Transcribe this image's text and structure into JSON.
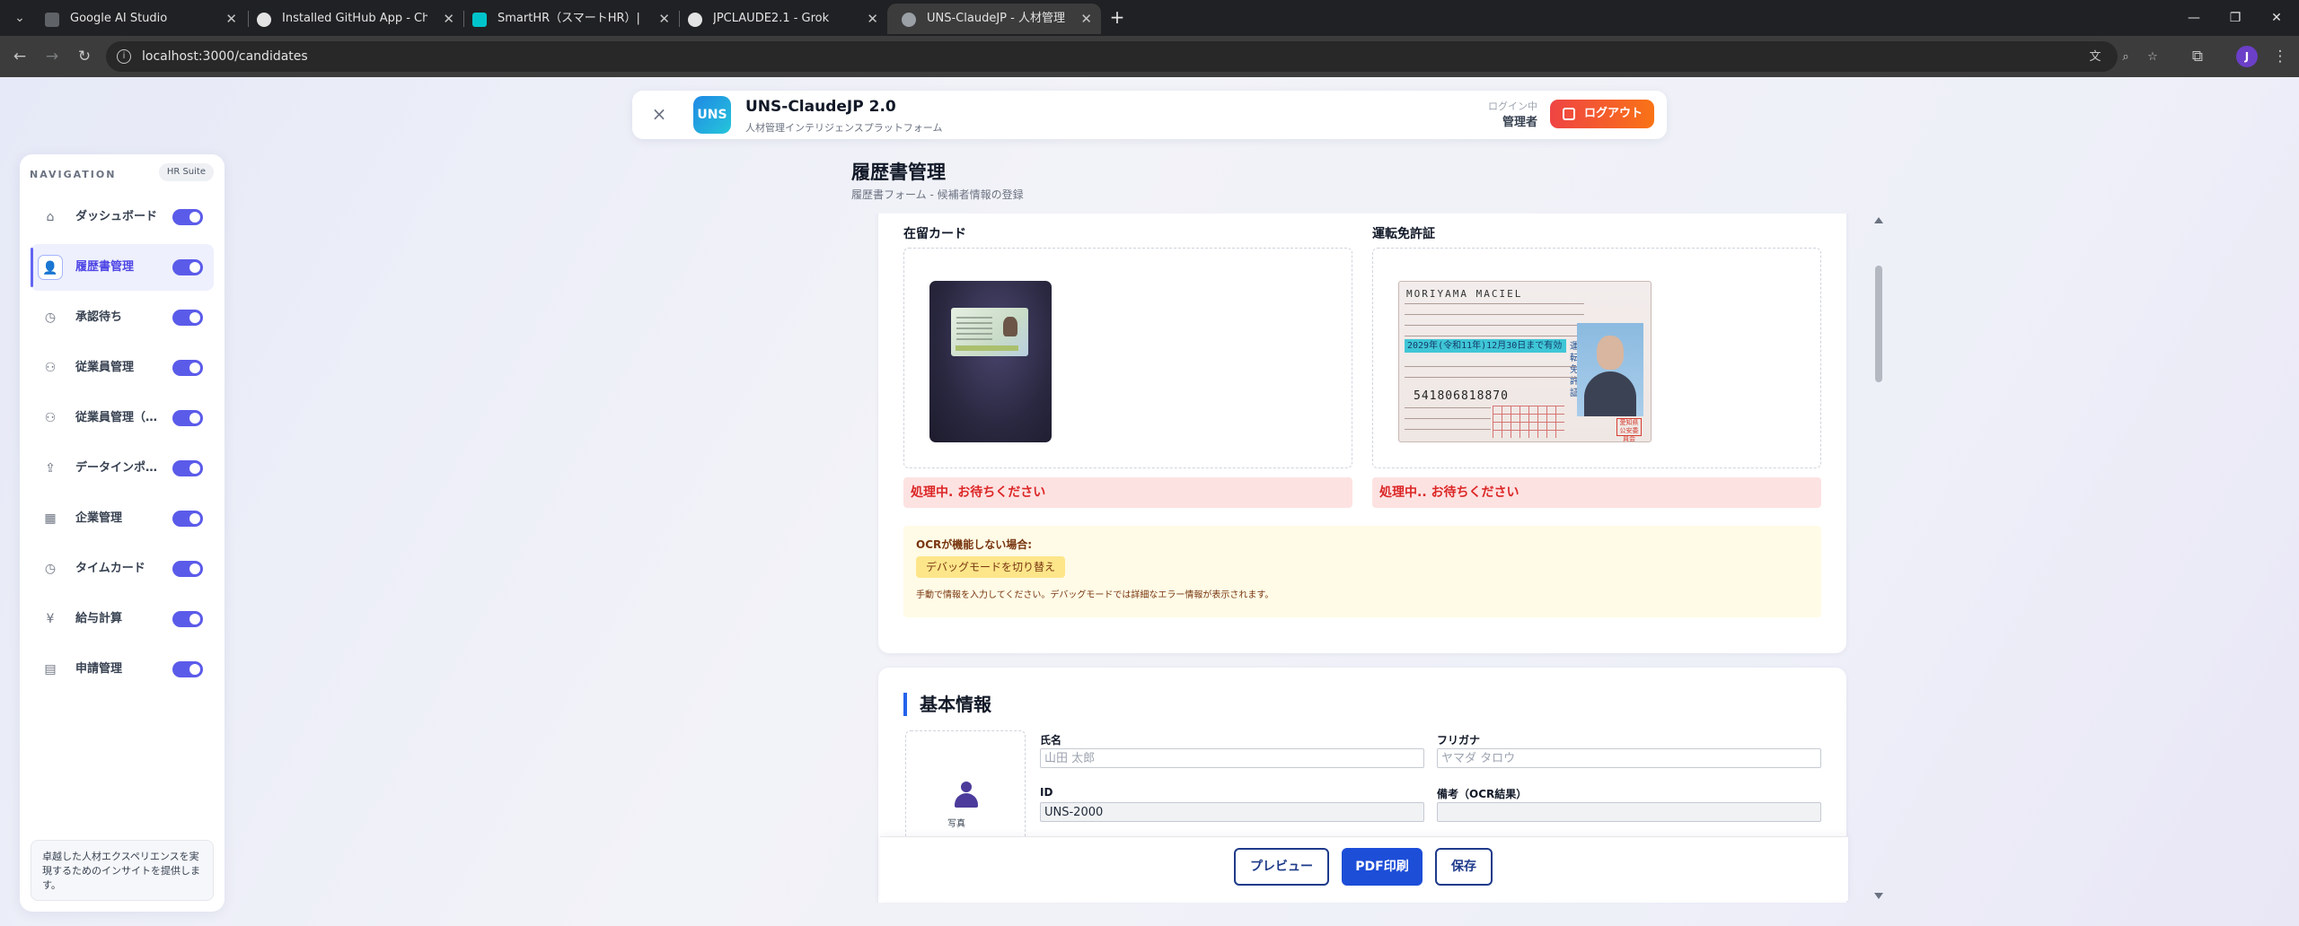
{
  "browser": {
    "tabs": [
      {
        "title": "Google AI Studio",
        "favicon_color": "#5f6368"
      },
      {
        "title": "Installed GitHub App - ChatGPT",
        "favicon_color": "#e3e3e3"
      },
      {
        "title": "SmartHR（スマートHR）| シェアNo.1",
        "favicon_color": "#00c4cc"
      },
      {
        "title": "JPCLAUDE2.1 - Grok",
        "favicon_color": "#e3e3e3"
      },
      {
        "title": "UNS-ClaudeJP - 人材管理システム",
        "favicon_color": "#9aa0a6"
      }
    ],
    "url": "localhost:3000/candidates",
    "profile_initial": "J"
  },
  "header": {
    "close_icon": "×",
    "logo": "UNS",
    "title": "UNS-ClaudeJP 2.0",
    "subtitle": "人材管理インテリジェンスプラットフォーム",
    "login_status": "ログイン中",
    "user": "管理者",
    "logout_label": "ログアウト"
  },
  "sidebar": {
    "title": "NAVIGATION",
    "badge": "HR Suite",
    "items": [
      {
        "label": "ダッシュボード",
        "icon": "⌂"
      },
      {
        "label": "履歴書管理",
        "icon": "👤"
      },
      {
        "label": "承認待ち",
        "icon": "◷"
      },
      {
        "label": "従業員管理",
        "icon": "⚇"
      },
      {
        "label": "従業員管理（派遣）",
        "icon": "⚇"
      },
      {
        "label": "データインポート",
        "icon": "⇪"
      },
      {
        "label": "企業管理",
        "icon": "▦"
      },
      {
        "label": "タイムカード",
        "icon": "◷"
      },
      {
        "label": "給与計算",
        "icon": "¥"
      },
      {
        "label": "申請管理",
        "icon": "▤"
      }
    ],
    "active_index": 1,
    "footer": "卓越した人材エクスペリエンスを実現するためのインサイトを提供します。"
  },
  "main": {
    "title": "履歴書管理",
    "subtitle": "履歴書フォーム - 候補者情報の登録",
    "documents": {
      "zairyu_label": "在留カード",
      "license_label": "運転免許証",
      "zairyu_status": "処理中. お待ちください",
      "license_status": "処理中.. お待ちください",
      "license_image": {
        "name": "MORIYAMA MACIEL",
        "expiry": "2029年(令和11年)12月30日まで有効",
        "number": "541806818870",
        "vertical": "運転免許証",
        "stamp": "愛知県公安委員会"
      }
    },
    "ocr": {
      "title": "OCRが機能しない場合:",
      "debug_button": "デバッグモードを切り替え",
      "note": "手動で情報を入力してください。デバッグモードでは詳細なエラー情報が表示されます。"
    },
    "basic_info": {
      "title": "基本情報",
      "photo_label": "写真",
      "name_label": "氏名",
      "name_placeholder": "山田 太郎",
      "furigana_label": "フリガナ",
      "furigana_placeholder": "ヤマダ タロウ",
      "id_label": "ID",
      "id_value": "UNS-2000",
      "remarks_label": "備考（OCR結果）",
      "remarks_value": ""
    },
    "actions": {
      "preview": "プレビュー",
      "pdf": "PDF印刷",
      "save": "保存"
    }
  },
  "colors": {
    "accent": "#6366f1",
    "primary_button": "#1d4ed8",
    "logout_gradient_start": "#ef4444",
    "logout_gradient_end": "#f97316",
    "error_bg": "#fde2e2",
    "warning_bg": "#fffbe6"
  }
}
